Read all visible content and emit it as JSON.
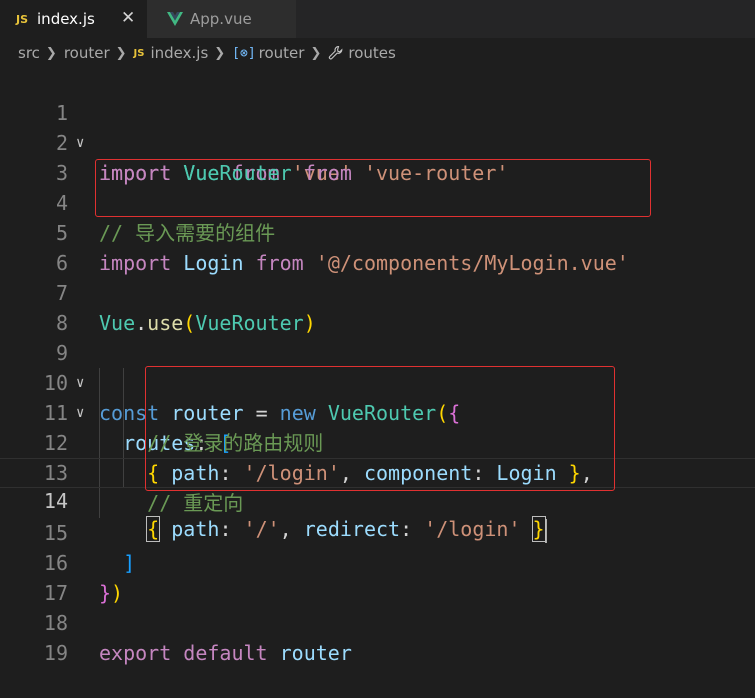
{
  "tabs": [
    {
      "badge": "JS",
      "label": "index.js",
      "close": "✕"
    },
    {
      "label": "App.vue"
    }
  ],
  "breadcrumb": {
    "src": "src",
    "router": "router",
    "file_badge": "JS",
    "file": "index.js",
    "fn_icon": "[⊗]",
    "symbol": "router",
    "leaf": "routes"
  },
  "code": {
    "l1": {
      "n": "1",
      "a": "import",
      "b": "Vue",
      "c": "from",
      "d": "'vue'"
    },
    "l2": {
      "n": "2",
      "a": "import",
      "b": "VueRouter",
      "c": "from",
      "d": "'vue-router'"
    },
    "l3": {
      "n": "3"
    },
    "l4": {
      "n": "4",
      "a": "// 导入需要的组件"
    },
    "l5": {
      "n": "5",
      "a": "import",
      "b": "Login",
      "c": "from",
      "d": "'@/components/MyLogin.vue'"
    },
    "l6": {
      "n": "6"
    },
    "l7": {
      "n": "7",
      "a": "Vue",
      "b": ".",
      "c": "use",
      "d": "(",
      "e": "VueRouter",
      "f": ")"
    },
    "l8": {
      "n": "8"
    },
    "l9": {
      "n": "9",
      "a": "const",
      "b": "router",
      "c": "=",
      "d": "new",
      "e": "VueRouter",
      "f": "(",
      "g": "{"
    },
    "l10": {
      "n": "10",
      "a": "routes",
      "b": ": ",
      "c": "["
    },
    "l11": {
      "n": "11",
      "a": "// 登录的路由规则"
    },
    "l12": {
      "n": "12",
      "a": "{",
      "b": "path",
      "c": ": ",
      "d": "'/login'",
      "e": ", ",
      "f": "component",
      "g": ": ",
      "h": "Login",
      "i": " }",
      "j": ","
    },
    "l13": {
      "n": "13",
      "a": "// 重定向"
    },
    "l14": {
      "n": "14",
      "a": "{",
      "b": "path",
      "c": ": ",
      "d": "'/'",
      "e": ", ",
      "f": "redirect",
      "g": ": ",
      "h": "'/login'",
      "i": " ",
      "j": "}"
    },
    "l15": {
      "n": "15",
      "a": "]"
    },
    "l16": {
      "n": "16",
      "a": "}",
      "b": ")"
    },
    "l17": {
      "n": "17"
    },
    "l18": {
      "n": "18",
      "a": "export",
      "b": "default",
      "c": "router"
    },
    "l19": {
      "n": "19"
    }
  },
  "colors": {
    "keyword": "#c586c0",
    "identifier": "#9cdcfe",
    "class": "#4ec9b0",
    "string": "#ce9178",
    "comment": "#6a9955",
    "highlight_box": "#e03131"
  }
}
